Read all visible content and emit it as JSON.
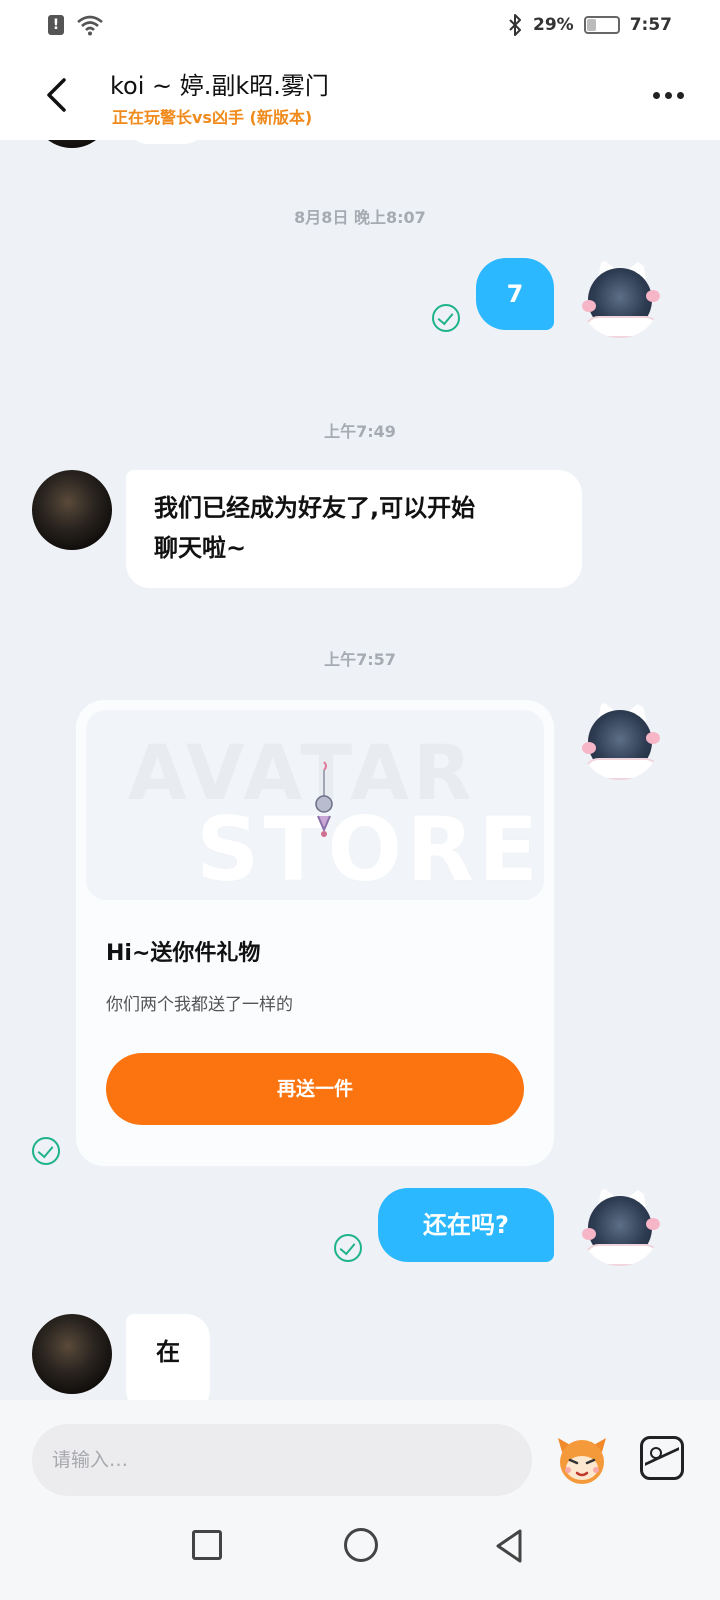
{
  "status_bar": {
    "battery_percent": "29%",
    "battery_level": 0.29,
    "time": "7:57",
    "icons": [
      "alert-icon",
      "wifi-icon",
      "bluetooth-icon",
      "battery-icon"
    ]
  },
  "header": {
    "title": "koi ~ 婷.副k昭.雾门",
    "subtitle": "正在玩警长vs凶手 (新版本)",
    "subtitle_color": "#f08a1c",
    "icons": [
      "back-arrow-icon",
      "more-dots-icon"
    ]
  },
  "messages": {
    "ts1": "8月8日 晚上8:07",
    "msg1": "7",
    "ts2": "上午7:49",
    "msg2_line1": "我们已经成为好友了,可以开始",
    "msg2_line2": "聊天啦~",
    "ts3": "上午7:57",
    "gift": {
      "watermark_line1": "AVATAR",
      "watermark_line2": "STORE",
      "title": "Hi~送你件礼物",
      "description": "你们两个我都送了一样的",
      "button_label": "再送一件",
      "button_color": "#fb740f"
    },
    "msg3": "还在吗?",
    "msg4": "在"
  },
  "colors": {
    "outgoing_bubble": "#2bb8ff",
    "read_check": "#1fb38a",
    "background": "#eef1f6"
  },
  "input": {
    "placeholder": "请输入…",
    "icons": [
      "emoji-mascot-icon",
      "image-picker-icon"
    ]
  },
  "nav": {
    "icons": [
      "recent-apps-square-icon",
      "home-circle-icon",
      "back-triangle-icon"
    ]
  }
}
